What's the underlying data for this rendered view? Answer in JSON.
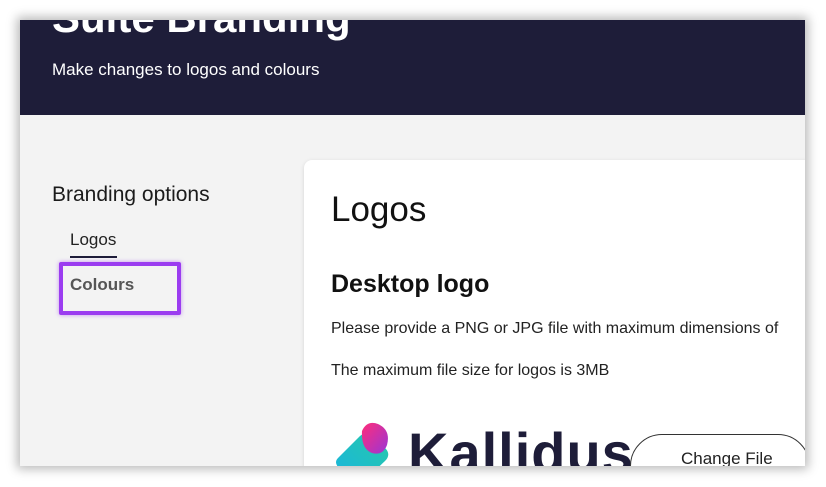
{
  "header": {
    "title": "Suite Branding",
    "subtitle": "Make changes to logos and colours"
  },
  "sidebar": {
    "heading": "Branding options",
    "items": [
      {
        "label": "Logos",
        "active": true
      },
      {
        "label": "Colours",
        "highlighted": true
      }
    ]
  },
  "main": {
    "title": "Logos",
    "section_title": "Desktop logo",
    "instruction": "Please provide a PNG or JPG file with maximum dimensions of",
    "max_size_text": "The maximum file size for logos is 3MB",
    "logo_text": "Kallidus",
    "change_button": "Change File"
  },
  "colors": {
    "header_bg": "#1e1d39",
    "highlight": "#9b3cf0",
    "page_bg": "#f3f3f3"
  }
}
